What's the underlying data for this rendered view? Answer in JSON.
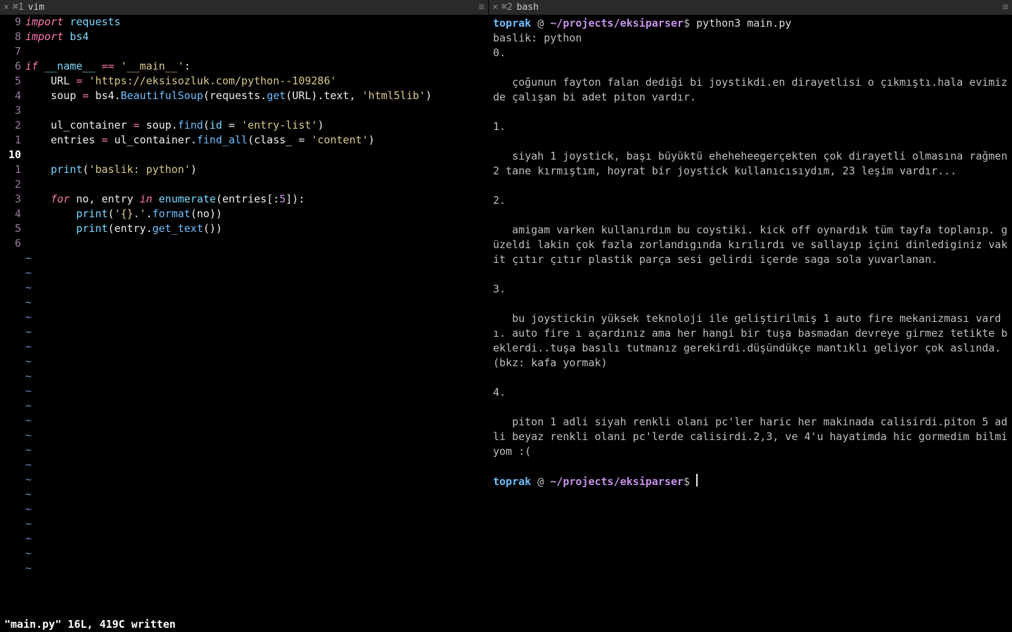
{
  "left": {
    "tab": {
      "close": "×",
      "index": "⌘1",
      "title": "vim",
      "hamburger": "≡"
    },
    "gutter": [
      "9",
      "8",
      "7",
      "6",
      "5",
      "4",
      "3",
      "2",
      "1",
      "10",
      "1",
      "2",
      "3",
      "4",
      "5",
      "6"
    ],
    "gutter_current_index": 9,
    "tilde_count": 22,
    "status": "\"main.py\" 16L, 419C written",
    "code": {
      "l1": {
        "kw": "import",
        "mod": "requests"
      },
      "l2": {
        "kw": "import",
        "mod": "bs4"
      },
      "l4": {
        "if": "if",
        "name": "__name__",
        "eq": "==",
        "main": "'__main__'",
        "colon": ":"
      },
      "l5": {
        "var": "URL",
        "eq": "=",
        "str": "'https://eksisozluk.com/python--109286'"
      },
      "l6": {
        "var": "soup",
        "eq": "=",
        "bs4": "bs4",
        "dot1": ".",
        "bsoup": "BeautifulSoup",
        "op1": "(",
        "req": "requests",
        "dot2": ".",
        "get": "get",
        "op2": "(",
        "url": "URL",
        "op3": ").",
        "text": "text",
        "comma": ", ",
        "lib": "'html5lib'",
        "op4": ")"
      },
      "l8": {
        "var": "ul_container",
        "eq": "=",
        "soup": "soup",
        "dot": ".",
        "find": "find",
        "op1": "(",
        "idkw": "id",
        "eq2": " = ",
        "str": "'entry-list'",
        "op2": ")"
      },
      "l9": {
        "var": "entries",
        "eq": "=",
        "uc": "ul_container",
        "dot": ".",
        "fa": "find_all",
        "op1": "(",
        "cls": "class_",
        "eq2": " = ",
        "str": "'content'",
        "op2": ")"
      },
      "l11": {
        "print": "print",
        "op1": "(",
        "str": "'baslik: python'",
        "op2": ")"
      },
      "l13": {
        "for": "for",
        "vars": "no, entry",
        "in": "in",
        "enum": "enumerate",
        "op1": "(",
        "ent": "entries",
        "sl1": "[:",
        "five": "5",
        "sl2": "]):",
        "colon": ""
      },
      "l14": {
        "print": "print",
        "op1": "(",
        "fmt": "'{}.'",
        "dot": ".",
        "format": "format",
        "op2": "(",
        "no": "no",
        "op3": "))"
      },
      "l15": {
        "print": "print",
        "op1": "(",
        "ent": "entry",
        "dot": ".",
        "gt": "get_text",
        "op2": "())"
      }
    }
  },
  "right": {
    "tab": {
      "close": "×",
      "index": "⌘2",
      "title": "bash",
      "hamburger": "≡"
    },
    "prompt": {
      "user": "toprak",
      "at": " @ ",
      "path": "~/projects/eksiparser",
      "ps": "$ "
    },
    "cmd": "python3 main.py",
    "lines": [
      "baslik: python",
      "0.",
      "",
      "   çoğunun fayton falan dediği bi joystikdi.en dirayetlisi o çıkmıştı.hala evimizde çalışan bi adet piton vardır.",
      "",
      "1.",
      "",
      "   siyah 1 joystick, başı büyüktü eheheheegerçekten çok dirayetli olmasına rağmen 2 tane kırmıştım, hoyrat bir joystick kullanıcısıydım, 23 leşim vardır...",
      "",
      "2.",
      "",
      "   amigam varken kullanırdım bu coystiki. kick off oynardık tüm tayfa toplanıp. güzeldi lakin çok fazla zorlandıgında kırılırdı ve sallayıp içini dinlediginiz vakit çıtır çıtır plastik parça sesi gelirdi içerde saga sola yuvarlanan.",
      "",
      "3.",
      "",
      "   bu joystickin yüksek teknoloji ile geliştirilmiş 1 auto fire mekanizması vardı. auto fire ı açardınız ama her hangi bir tuşa basmadan devreye girmez tetikte beklerdi..tuşa basılı tutmanız gerekirdi.düşündükçe mantıklı geliyor çok aslında.(bkz: kafa yormak)",
      "",
      "4.",
      "",
      "   piton 1 adli siyah renkli olani pc'ler haric her makinada calisirdi.piton 5 adli beyaz renkli olani pc'lerde calisirdi.2,3, ve 4'u hayatimda hic gormedim bilmiyom :(",
      ""
    ]
  }
}
